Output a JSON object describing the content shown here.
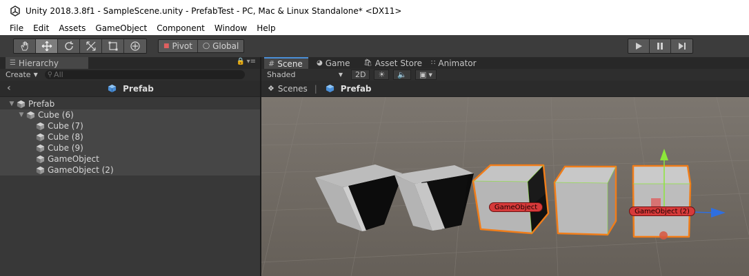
{
  "window": {
    "title": "Unity 2018.3.8f1 - SampleScene.unity - PrefabTest - PC, Mac & Linux Standalone* <DX11>"
  },
  "menu": [
    "File",
    "Edit",
    "Assets",
    "GameObject",
    "Component",
    "Window",
    "Help"
  ],
  "toolbar": {
    "tools": [
      "hand-icon",
      "move-icon",
      "rotate-icon",
      "scale-icon",
      "rect-icon",
      "transform-icon"
    ],
    "pivot_label": "Pivot",
    "global_label": "Global"
  },
  "hierarchy": {
    "tab_label": "Hierarchy",
    "create_label": "Create",
    "search_placeholder": "All",
    "prefab_title": "Prefab",
    "items": [
      {
        "label": "Prefab"
      },
      {
        "label": "Cube (6)"
      },
      {
        "label": "Cube (7)"
      },
      {
        "label": "Cube (8)"
      },
      {
        "label": "Cube (9)"
      },
      {
        "label": "GameObject"
      },
      {
        "label": "GameObject (2)"
      }
    ]
  },
  "scene": {
    "tabs": [
      {
        "label": "Scene"
      },
      {
        "label": "Game"
      },
      {
        "label": "Asset Store"
      },
      {
        "label": "Animator"
      }
    ],
    "shading_mode": "Shaded",
    "mode_2d_label": "2D",
    "breadcrumb": {
      "root": "Scenes",
      "current": "Prefab"
    },
    "labels": [
      "GameObject",
      "GameObject (2)"
    ]
  },
  "colors": {
    "selection_outline": "#f07d1a",
    "gizmo_label": "#d63a3a",
    "axis_y": "#8ce63a",
    "axis_x": "#2f6fe0"
  }
}
